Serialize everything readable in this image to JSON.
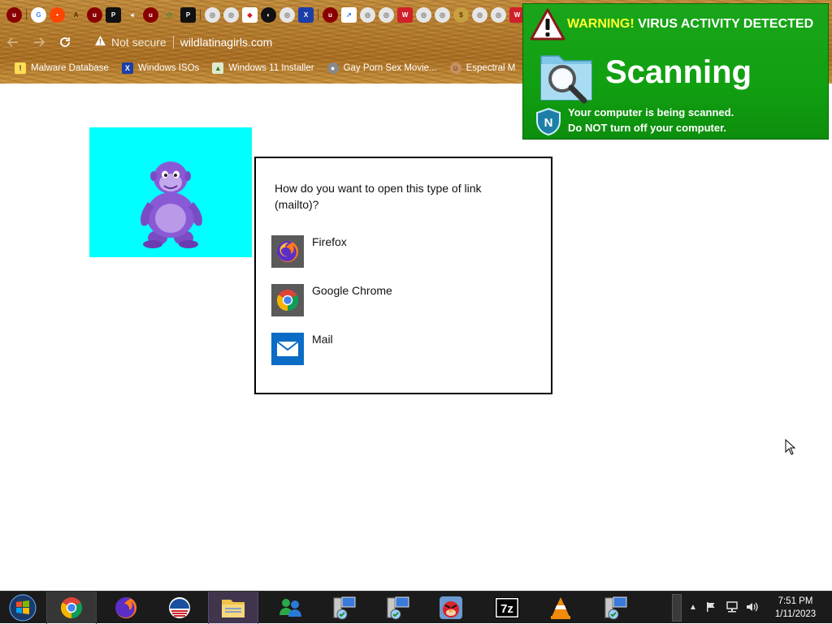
{
  "browser": {
    "tab_icons": [
      "ublock",
      "google",
      "reddit",
      "a",
      "ublock",
      "pbn",
      "speaker",
      "ublock",
      "spiral",
      "pbn",
      "globe",
      "globe",
      "lips",
      "game",
      "globe",
      "x-app",
      "ublock",
      "chart",
      "globe",
      "globe",
      "wtf",
      "globe",
      "globe",
      "coin",
      "globe",
      "globe",
      "wtf",
      "globe"
    ],
    "url_bar": {
      "security_label": "Not secure",
      "url": "wildlatinagirls.com"
    },
    "bookmarks": [
      {
        "label": "Malware Database",
        "icon": "warning-icon"
      },
      {
        "label": "Windows ISOs",
        "icon": "x-icon"
      },
      {
        "label": "Windows 11 Installer",
        "icon": "image-icon"
      },
      {
        "label": "Gay Porn Sex Movie...",
        "icon": "disc-icon"
      },
      {
        "label": "Espectral M",
        "icon": "face-icon"
      }
    ]
  },
  "scam_popup": {
    "warning_prefix": "WARNING!",
    "warning_rest": "VIRUS ACTIVITY DETECTED",
    "title": "Scanning",
    "line1": "Your computer is being scanned.",
    "line2_prefix": "Do",
    "line2_bold": "NOT",
    "line2_suffix": "turn off your computer.",
    "colors": {
      "background": "#11a011",
      "warning_yellow": "#ffff2e"
    }
  },
  "dialog": {
    "question": "How do you want to open this type of link (mailto)?",
    "apps": [
      {
        "label": "Firefox",
        "icon": "firefox-icon"
      },
      {
        "label": "Google Chrome",
        "icon": "chrome-icon"
      },
      {
        "label": "Mail",
        "icon": "mail-icon"
      }
    ]
  },
  "taskbar": {
    "apps": [
      "start-orb",
      "chrome",
      "firefox",
      "obama-logo",
      "file-explorer",
      "msn-messenger",
      "network-installer",
      "network-installer",
      "angry-birds",
      "7zip",
      "vlc",
      "network-installer"
    ],
    "clock": {
      "time": "7:51 PM",
      "date": "1/11/2023"
    }
  }
}
